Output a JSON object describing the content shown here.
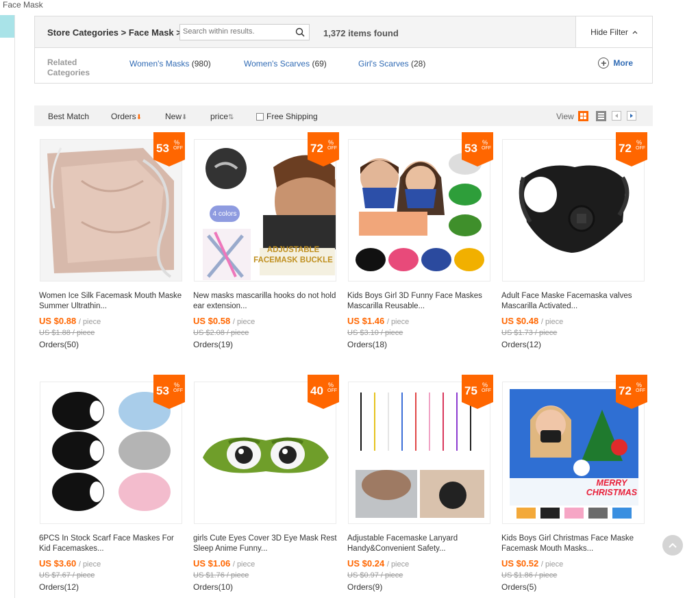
{
  "page_label": "Face Mask",
  "filter": {
    "crumb_root": "Store Categories",
    "crumb_sep1": ">",
    "crumb_current": "Face Mask",
    "crumb_sep2": ">",
    "search_placeholder": "Search within results.",
    "items_found": "1,372 items found",
    "hide_filter": "Hide Filter",
    "related_label": "Related Categories",
    "related": [
      {
        "name": "Women's Masks",
        "count": "(980)"
      },
      {
        "name": "Women's Scarves",
        "count": "(69)"
      },
      {
        "name": "Girl's Scarves",
        "count": "(28)"
      }
    ],
    "more": "More"
  },
  "sort": {
    "best_match": "Best Match",
    "orders": "Orders",
    "new": "New",
    "price": "price",
    "free_shipping": "Free Shipping",
    "view": "View"
  },
  "colors": {
    "accent": "#ff6600",
    "link": "#2f6ab4",
    "badge": "#ff6600"
  },
  "products": [
    {
      "discount": "53",
      "title": "Women Ice Silk Facemask Mouth Maske Summer Ultrathin...",
      "price": "US $0.88",
      "unit": "/ piece",
      "old_price": "US $1.88 / piece",
      "orders": "Orders(50)"
    },
    {
      "discount": "72",
      "title": "New masks mascarilla hooks do not hold ear extension...",
      "price": "US $0.58",
      "unit": "/ piece",
      "old_price": "US $2.08 / piece",
      "orders": "Orders(19)",
      "img_text1": "4 colors",
      "img_text2": "ADJUSTABLE",
      "img_text3": "FACEMASK BUCKLE"
    },
    {
      "discount": "53",
      "title": "Kids Boys Girl 3D Funny Face Maskes Mascarilla Reusable...",
      "price": "US $1.46",
      "unit": "/ piece",
      "old_price": "US $3.10 / piece",
      "orders": "Orders(18)"
    },
    {
      "discount": "72",
      "title": "Adult Face Maske Facemaska valves Mascarilla Activated...",
      "price": "US $0.48",
      "unit": "/ piece",
      "old_price": "US $1.73 / piece",
      "orders": "Orders(12)"
    },
    {
      "discount": "53",
      "title": "6PCS In Stock Scarf Face Maskes For Kid Facemaskes...",
      "price": "US $3.60",
      "unit": "/ piece",
      "old_price": "US $7.67 / piece",
      "orders": "Orders(12)"
    },
    {
      "discount": "40",
      "title": "girls Cute Eyes Cover 3D Eye Mask Rest Sleep Anime Funny...",
      "price": "US $1.06",
      "unit": "/ piece",
      "old_price": "US $1.76 / piece",
      "orders": "Orders(10)"
    },
    {
      "discount": "75",
      "title": "Adjustable Facemaske Lanyard Handy&Convenient Safety...",
      "price": "US $0.24",
      "unit": "/ piece",
      "old_price": "US $0.97 / piece",
      "orders": "Orders(9)"
    },
    {
      "discount": "72",
      "title": "Kids Boys Girl Christmas Face Maske Facemask Mouth Masks...",
      "price": "US $0.52",
      "unit": "/ piece",
      "old_price": "US $1.86 / piece",
      "orders": "Orders(5)",
      "img_text1": "MERRY",
      "img_text2": "CHRISTMAS"
    }
  ],
  "badge_pct": "%",
  "badge_off": "OFF"
}
